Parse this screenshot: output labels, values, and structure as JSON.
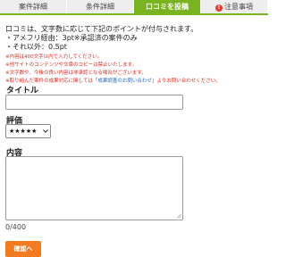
{
  "tabs": [
    {
      "label": "案件詳細",
      "active": false
    },
    {
      "label": "条件詳細",
      "active": false
    },
    {
      "label": "口コミを投稿",
      "active": true
    },
    {
      "label": "注意事項",
      "active": false,
      "icon": "warning-icon"
    }
  ],
  "notes": {
    "lines": [
      "口コミは、文字数に応じて下記のポイントが付与されます。",
      "・アメフリ経由：3pt※承認済の案件のみ",
      "・それ以外：0.5pt"
    ],
    "red_lines": [
      "※内容は400文字以内で入力してください。",
      "※他サイトのコンテンツや文章のコピーは禁止いたします。",
      "※文字数や、今後の良い内容は非承認となる場合がございます。"
    ],
    "red_last_prefix": "※取り組んだ案件の成果対応に関しては「",
    "red_last_link": "成果調査のお問い合わせ",
    "red_last_suffix": "」よりお問い合わせください。"
  },
  "form": {
    "title_label": "タイトル",
    "title_value": "",
    "rating_label": "評価",
    "rating_value": "★★★★★",
    "content_label": "内容",
    "content_value": "",
    "counter": "0/400",
    "confirm_label": "確認へ"
  },
  "colors": {
    "accent": "#79b31f",
    "button": "#f47a20",
    "warning": "#e0261c",
    "link": "#1f64c8"
  }
}
